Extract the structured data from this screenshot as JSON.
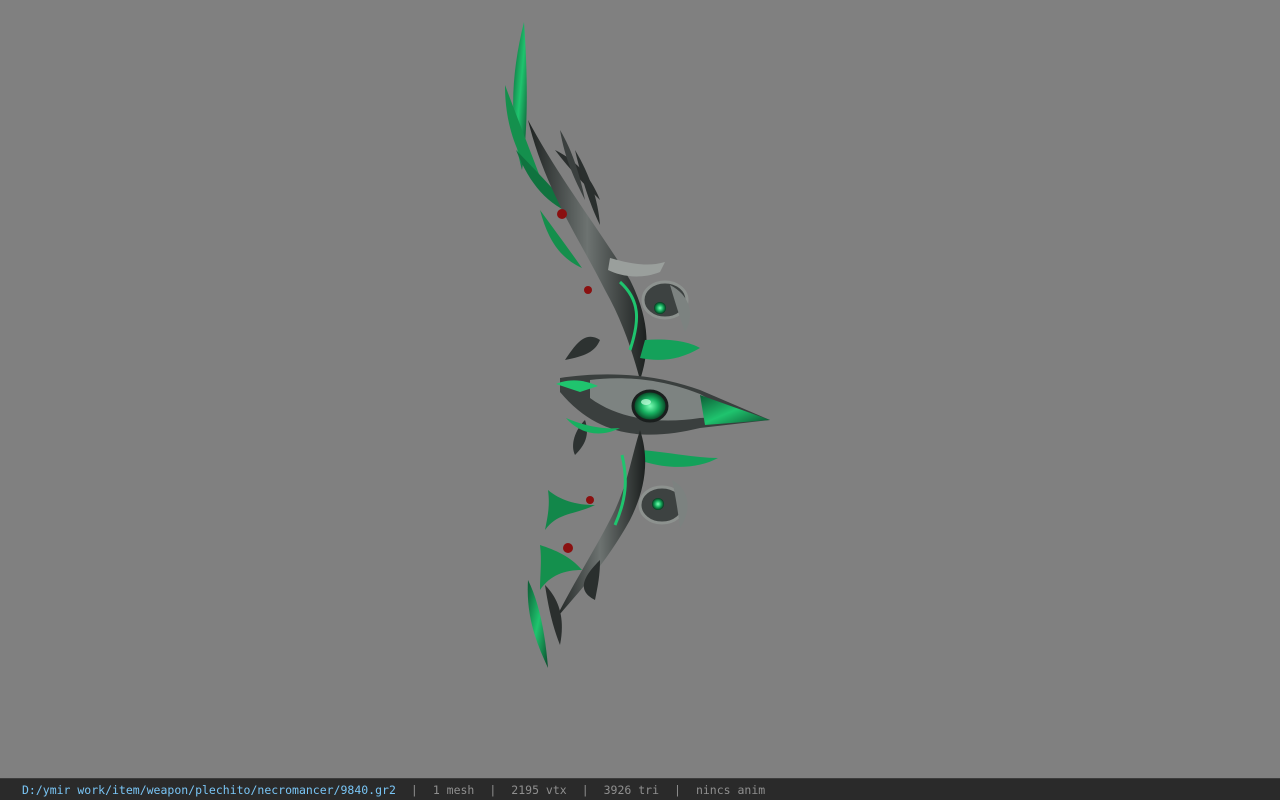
{
  "viewer": {
    "background_color": "#808080",
    "model_subject": "green-black ornate bow (necromancer weapon)",
    "accent_colors": {
      "emerald": "#16a35a",
      "dark_metal": "#2b2f2e",
      "steel": "#8a8f8d",
      "gem_red": "#8a1010"
    }
  },
  "status_bar": {
    "path": "D:/ymir work/item/weapon/plechito/necromancer/9840.gr2",
    "mesh_count": "1 mesh",
    "vertex_count": "2195 vtx",
    "triangle_count": "3926 tri",
    "animation": "nincs anim",
    "separator": "|",
    "path_color": "#79c5f5",
    "text_color": "#8f8f8f"
  }
}
